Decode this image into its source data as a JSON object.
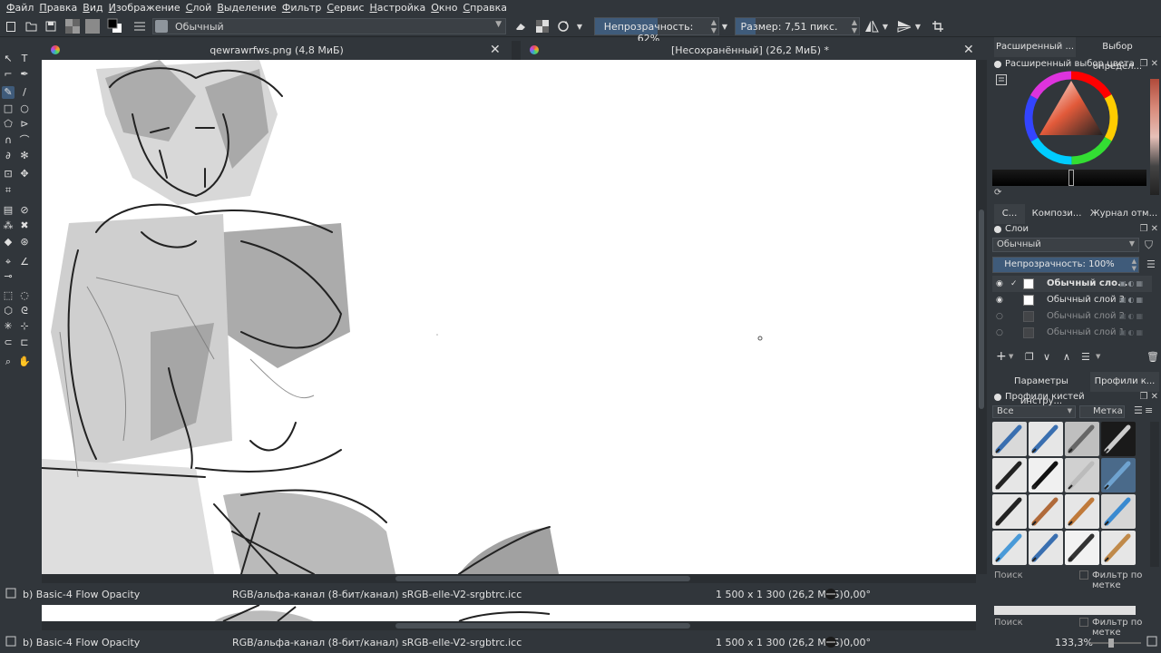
{
  "menu": [
    "Файл",
    "Правка",
    "Вид",
    "Изображение",
    "Слой",
    "Выделение",
    "Фильтр",
    "Сервис",
    "Настройка",
    "Окно",
    "Справка"
  ],
  "toolbar": {
    "blend_mode": "Обычный",
    "opacity_label": "Непрозрачность: 62%",
    "opacity_value": 62,
    "size_label": "Размер: 7,51 пикс."
  },
  "tabs": [
    {
      "title": "qewrawrfws.png (4,8 МиБ)"
    },
    {
      "title": "[Несохранённый]  (26,2 МиБ) *"
    }
  ],
  "status": {
    "preset": "b) Basic-4 Flow Opacity",
    "color_space": "RGB/альфа-канал (8-бит/канал)  sRGB-elle-V2-srgbtrc.icc",
    "dimensions": "1 500 x 1 300 (26,2 МиБ)",
    "rotation": "0,00°",
    "zoom": "133,3%"
  },
  "docker": {
    "top_tabs": [
      "Расширенный ...",
      "Выбор определ..."
    ],
    "color_panel_title": "Расширенный выбор цвета",
    "mid_tabs": [
      "С...",
      "Компози...",
      "Журнал отм..."
    ],
    "layers_title": "Слои",
    "layer_blend": "Обычный",
    "layer_opacity": "Непрозрачность:  100%",
    "layers": [
      {
        "name": "Обычный сло...",
        "visible": true,
        "active": true
      },
      {
        "name": "Обычный слой 3",
        "visible": true,
        "active": false
      },
      {
        "name": "Обычный слой 2",
        "visible": false,
        "active": false
      },
      {
        "name": "Обычный слой 1",
        "visible": false,
        "active": false
      }
    ],
    "bottom_tabs": [
      "Параметры инстру...",
      "Профили к..."
    ],
    "brushes_title": "Профили кистей",
    "brush_filter": "Все",
    "brush_tag": "Метка",
    "search_label": "Поиск",
    "filter_by_tag": "Фильтр по метке"
  },
  "colors": {
    "bg": "#31363b",
    "accent": "#3f5b7a",
    "canvas": "#ffffff"
  }
}
